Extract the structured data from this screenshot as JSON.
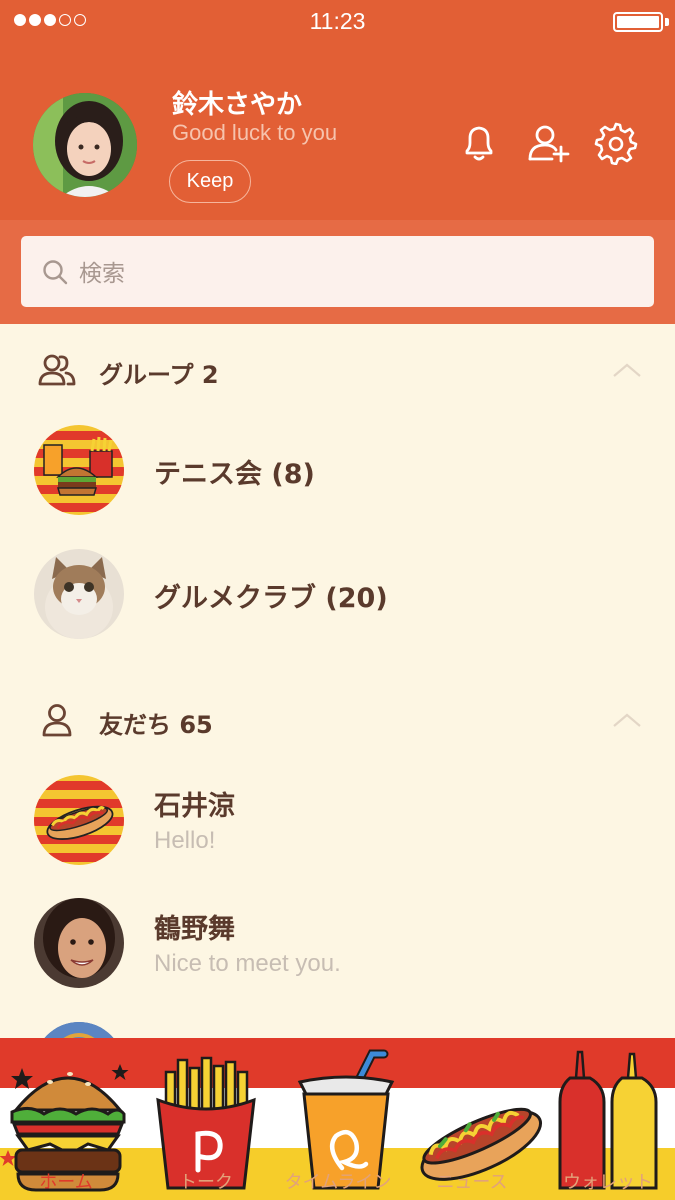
{
  "status_bar": {
    "time": "11:23"
  },
  "profile": {
    "name": "鈴木さやか",
    "status": "Good luck to you",
    "keep_label": "Keep"
  },
  "search": {
    "placeholder": "検索"
  },
  "groups": {
    "title": "グループ 2",
    "items": [
      {
        "name": "テニス会 (8)"
      },
      {
        "name": "グルメクラブ (20)"
      }
    ]
  },
  "friends": {
    "title": "友だち 65",
    "items": [
      {
        "name": "石井涼",
        "message": "Hello!"
      },
      {
        "name": "鶴野舞",
        "message": "Nice to meet you."
      }
    ]
  },
  "tabs": [
    {
      "label": "ホーム"
    },
    {
      "label": "トーク"
    },
    {
      "label": "タイムライン"
    },
    {
      "label": "ニュース"
    },
    {
      "label": "ウォレット"
    }
  ],
  "colors": {
    "header": "#e25f35",
    "search_band": "#e66b45",
    "list_background": "#fdf6e3",
    "text_brown": "#5a3a2c",
    "tab_red": "#e03a2a",
    "tab_yellow": "#f6cd2a"
  }
}
